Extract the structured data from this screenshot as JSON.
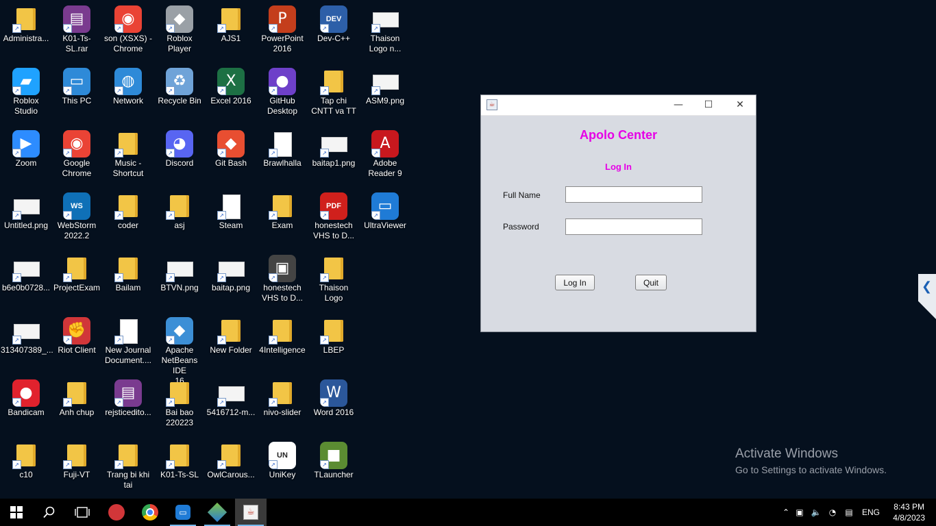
{
  "desktop_icons": [
    {
      "label": "Administra...",
      "icon": "user-folder-icon"
    },
    {
      "label": "Roblox\nStudio",
      "icon": "roblox-studio-icon"
    },
    {
      "label": "Zoom",
      "icon": "zoom-icon"
    },
    {
      "label": "Untitled.png",
      "icon": "image-file-icon"
    },
    {
      "label": "b6e0b0728...",
      "icon": "image-file-icon"
    },
    {
      "label": "313407389_...",
      "icon": "image-file-icon"
    },
    {
      "label": "Bandicam",
      "icon": "bandicam-icon"
    },
    {
      "label": "c10",
      "icon": "folder-icon"
    },
    {
      "label": "K01-Ts-SL.rar",
      "icon": "winrar-icon"
    },
    {
      "label": "This PC",
      "icon": "this-pc-icon"
    },
    {
      "label": "Google\nChrome",
      "icon": "chrome-icon"
    },
    {
      "label": "WebStorm\n2022.2",
      "icon": "webstorm-icon"
    },
    {
      "label": "ProjectExam",
      "icon": "folder-icon"
    },
    {
      "label": "Riot Client",
      "icon": "riot-client-icon"
    },
    {
      "label": "Anh chup",
      "icon": "folder-icon"
    },
    {
      "label": "Fuji-VT",
      "icon": "folder-icon"
    },
    {
      "label": "son (XSXS) -\nChrome",
      "icon": "chrome-profile-icon"
    },
    {
      "label": "Network",
      "icon": "network-icon"
    },
    {
      "label": "Music -\nShortcut",
      "icon": "music-folder-icon"
    },
    {
      "label": "coder",
      "icon": "folder-icon"
    },
    {
      "label": "Bailam",
      "icon": "folder-icon"
    },
    {
      "label": "New Journal\nDocument....",
      "icon": "journal-document-icon"
    },
    {
      "label": "rejsticedito...",
      "icon": "winrar-icon"
    },
    {
      "label": "Trang bi khi\ntai",
      "icon": "folder-icon"
    },
    {
      "label": "Roblox Player",
      "icon": "roblox-player-icon"
    },
    {
      "label": "Recycle Bin",
      "icon": "recycle-bin-icon"
    },
    {
      "label": "Discord",
      "icon": "discord-icon"
    },
    {
      "label": "asj",
      "icon": "folder-icon"
    },
    {
      "label": "BTVN.png",
      "icon": "image-file-icon"
    },
    {
      "label": "Apache\nNetBeans IDE\n16",
      "icon": "netbeans-icon"
    },
    {
      "label": "Bai bao\n220223",
      "icon": "folder-icon"
    },
    {
      "label": "K01-Ts-SL",
      "icon": "folder-icon"
    },
    {
      "label": "AJS1",
      "icon": "folder-icon"
    },
    {
      "label": "Excel 2016",
      "icon": "excel-icon"
    },
    {
      "label": "Git Bash",
      "icon": "git-bash-icon"
    },
    {
      "label": "Steam",
      "icon": "blank-file-icon"
    },
    {
      "label": "baitap.png",
      "icon": "image-file-icon"
    },
    {
      "label": "New Folder",
      "icon": "folder-icon"
    },
    {
      "label": "5416712-m...",
      "icon": "image-file-icon"
    },
    {
      "label": "OwlCarous...",
      "icon": "folder-icon"
    },
    {
      "label": "PowerPoint\n2016",
      "icon": "powerpoint-icon"
    },
    {
      "label": "GitHub\nDesktop",
      "icon": "github-desktop-icon"
    },
    {
      "label": "Brawlhalla",
      "icon": "blank-file-icon"
    },
    {
      "label": "Exam",
      "icon": "folder-icon"
    },
    {
      "label": "honestech\nVHS to D...",
      "icon": "vhs-icon"
    },
    {
      "label": "4Intelligence",
      "icon": "folder-icon"
    },
    {
      "label": "nivo-slider",
      "icon": "folder-icon"
    },
    {
      "label": "UniKey",
      "icon": "unikey-icon"
    },
    {
      "label": "Dev-C++",
      "icon": "devcpp-icon"
    },
    {
      "label": "Tap chi\nCNTT va TT",
      "icon": "folder-icon"
    },
    {
      "label": "baitap1.png",
      "icon": "image-file-icon"
    },
    {
      "label": "honestech\nVHS to D...",
      "icon": "pdf-icon"
    },
    {
      "label": "Thaison\nLogo",
      "icon": "folder-icon"
    },
    {
      "label": "LBEP",
      "icon": "folder-icon"
    },
    {
      "label": "Word 2016",
      "icon": "word-icon"
    },
    {
      "label": "TLauncher",
      "icon": "tlauncher-icon"
    },
    {
      "label": "Thaison\nLogo n...",
      "icon": "image-file-icon"
    },
    {
      "label": "ASM9.png",
      "icon": "image-file-icon"
    },
    {
      "label": "Adobe\nReader 9",
      "icon": "adobe-reader-icon"
    },
    {
      "label": "UltraViewer",
      "icon": "ultraviewer-icon"
    }
  ],
  "window": {
    "controls": {
      "minimize": "—",
      "maximize": "☐",
      "close": "✕"
    },
    "brand": "Apolo Center",
    "heading": "Log In",
    "fullname_label": "Full Name",
    "fullname_value": "",
    "password_label": "Password",
    "password_value": "",
    "login_button": "Log In",
    "quit_button": "Quit"
  },
  "sidetab": {
    "glyph": "❮"
  },
  "watermark": {
    "line1": "Activate Windows",
    "line2": "Go to Settings to activate Windows."
  },
  "taskbar": {
    "items": [
      "start-icon",
      "search-icon",
      "task-view-icon",
      "riot-client-icon",
      "chrome-icon",
      "ultraviewer-icon",
      "netbeans-icon",
      "java-icon"
    ],
    "language": "ENG",
    "time": "8:43 PM",
    "date": "4/8/2023"
  },
  "colors": {
    "brand": "#e600e6",
    "window_bg": "#d8dbe2",
    "desktop_bg": "#05101e"
  }
}
